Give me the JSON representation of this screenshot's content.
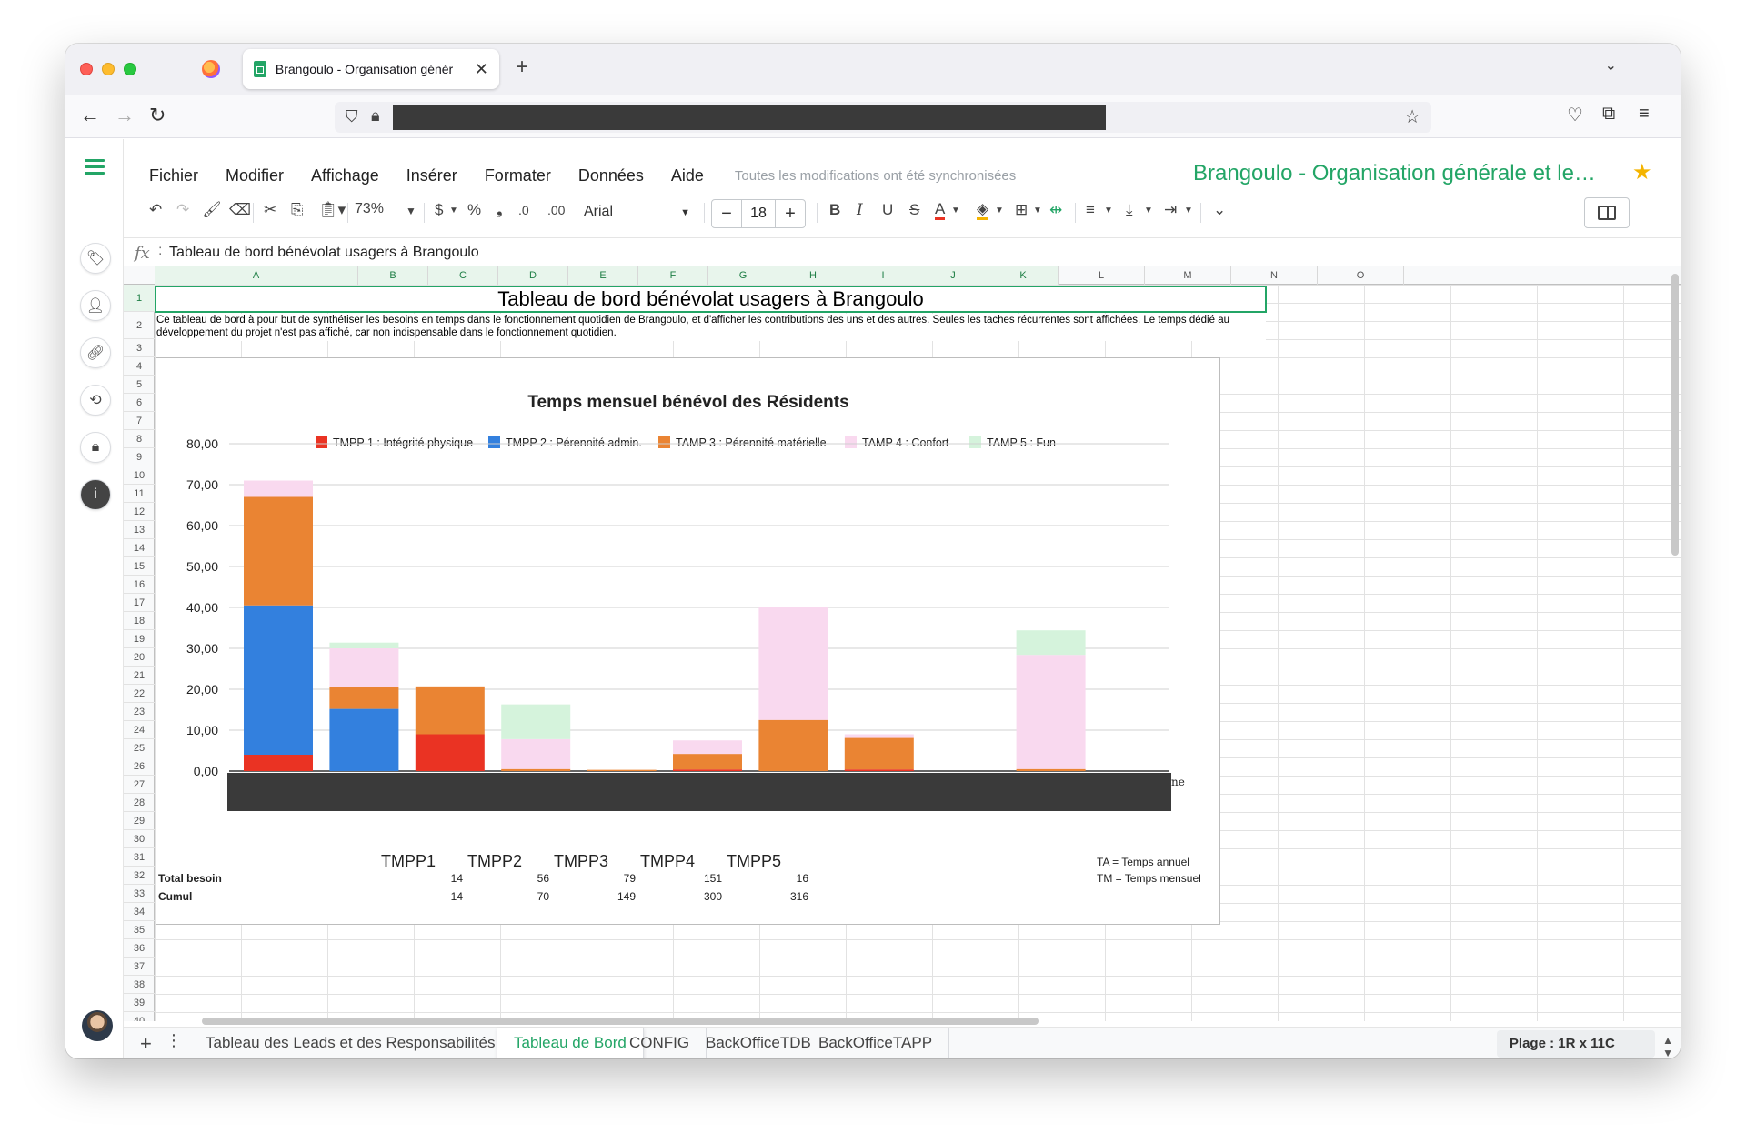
{
  "browser": {
    "tab_title": "Brangoulo - Organisation génér",
    "tab_close": "✕",
    "new_tab": "+"
  },
  "menu": {
    "items": [
      "Fichier",
      "Modifier",
      "Affichage",
      "Insérer",
      "Formater",
      "Données",
      "Aide"
    ],
    "sync_status": "Toutes les modifications ont été synchronisées"
  },
  "document": {
    "title": "Brangoulo - Organisation générale et le…"
  },
  "toolbar": {
    "zoom": "73%",
    "currency": "$",
    "percent": "%",
    "comma": "❟",
    "dec_minus": ".0",
    "dec_plus": ".00",
    "font": "Arial",
    "font_size": "18",
    "bold": "B",
    "italic": "I",
    "underline": "U",
    "strike": "S",
    "text_color": "A"
  },
  "formula": {
    "fx": "fx",
    "content": "Tableau de bord bénévolat usagers à Brangoulo"
  },
  "grid": {
    "columns": [
      "A",
      "B",
      "C",
      "D",
      "E",
      "F",
      "G",
      "H",
      "I",
      "J",
      "K",
      "L",
      "M",
      "N",
      "O"
    ],
    "title": "Tableau de bord bénévolat usagers à Brangoulo",
    "description": "Ce tableau de bord à pour but de synthétiser les besoins en temps dans le fonctionnement quotidien de Brangoulo, et d'afficher les contributions des uns et des autres. Seules les taches récurrentes sont affichées. Le temps dédié au développement du projet n'est pas affiché, car non indispensable dans le fonctionnement quotidien.",
    "row37_headers": [
      "TMPP1",
      "TMPP2",
      "TMPP3",
      "TMPP4",
      "TMPP5"
    ],
    "row37_note": "TA = Temps annuel",
    "row38_label": "Total besoin",
    "row38_values": [
      "14",
      "56",
      "79",
      "151",
      "16"
    ],
    "row38_note": "TM = Temps mensuel",
    "row39_label": "Cumul",
    "row39_values": [
      "14",
      "70",
      "149",
      "300",
      "316"
    ]
  },
  "chart_data": {
    "type": "bar",
    "stacked": true,
    "title": "Temps mensuel bénévol des Résidents",
    "ylim": [
      0,
      80
    ],
    "yticks": [
      "0,00",
      "10,00",
      "20,00",
      "30,00",
      "40,00",
      "50,00",
      "60,00",
      "70,00",
      "80,00"
    ],
    "legend_position": "top",
    "categories_hidden": true,
    "clipped_axis_label": "ne",
    "categories_count": 11,
    "series": [
      {
        "name": "TMPP 1 : Intégrité physique",
        "color": "#ea3323",
        "values": [
          4,
          0,
          9,
          0,
          0,
          0.4,
          0,
          0.4,
          0,
          0,
          0
        ]
      },
      {
        "name": "TMPP 2 : Pérennité admin.",
        "color": "#3380de",
        "values": [
          36.5,
          15.2,
          0,
          0,
          0,
          0,
          0,
          0,
          0,
          0,
          0
        ]
      },
      {
        "name": "TAMP 3 : Pérennité matérielle",
        "color": "#ea8433",
        "values": [
          26.5,
          5.4,
          11.7,
          0.5,
          0.3,
          3.8,
          12.5,
          7.7,
          0,
          0.5,
          0
        ]
      },
      {
        "name": "TAMP 4 : Confort",
        "color": "#f9d9ef",
        "values": [
          4,
          9.4,
          0,
          7.3,
          0,
          3.3,
          27.7,
          0.9,
          0,
          27.9,
          0
        ]
      },
      {
        "name": "TAMP 5 : Fun",
        "color": "#d5f3dc",
        "values": [
          0,
          1.4,
          0,
          8.5,
          0,
          0,
          0,
          0,
          0,
          6,
          0
        ]
      }
    ]
  },
  "sheets": {
    "tabs": [
      "Tableau des Leads et des Responsabilités",
      "Tableau de Bord",
      "CONFIG",
      "BackOfficeTDB",
      "BackOfficeTAPP"
    ],
    "active_index": 1,
    "range": "Plage : 1R x 11C"
  },
  "colors": {
    "brand": "#23a566",
    "selection": "#23a566"
  }
}
